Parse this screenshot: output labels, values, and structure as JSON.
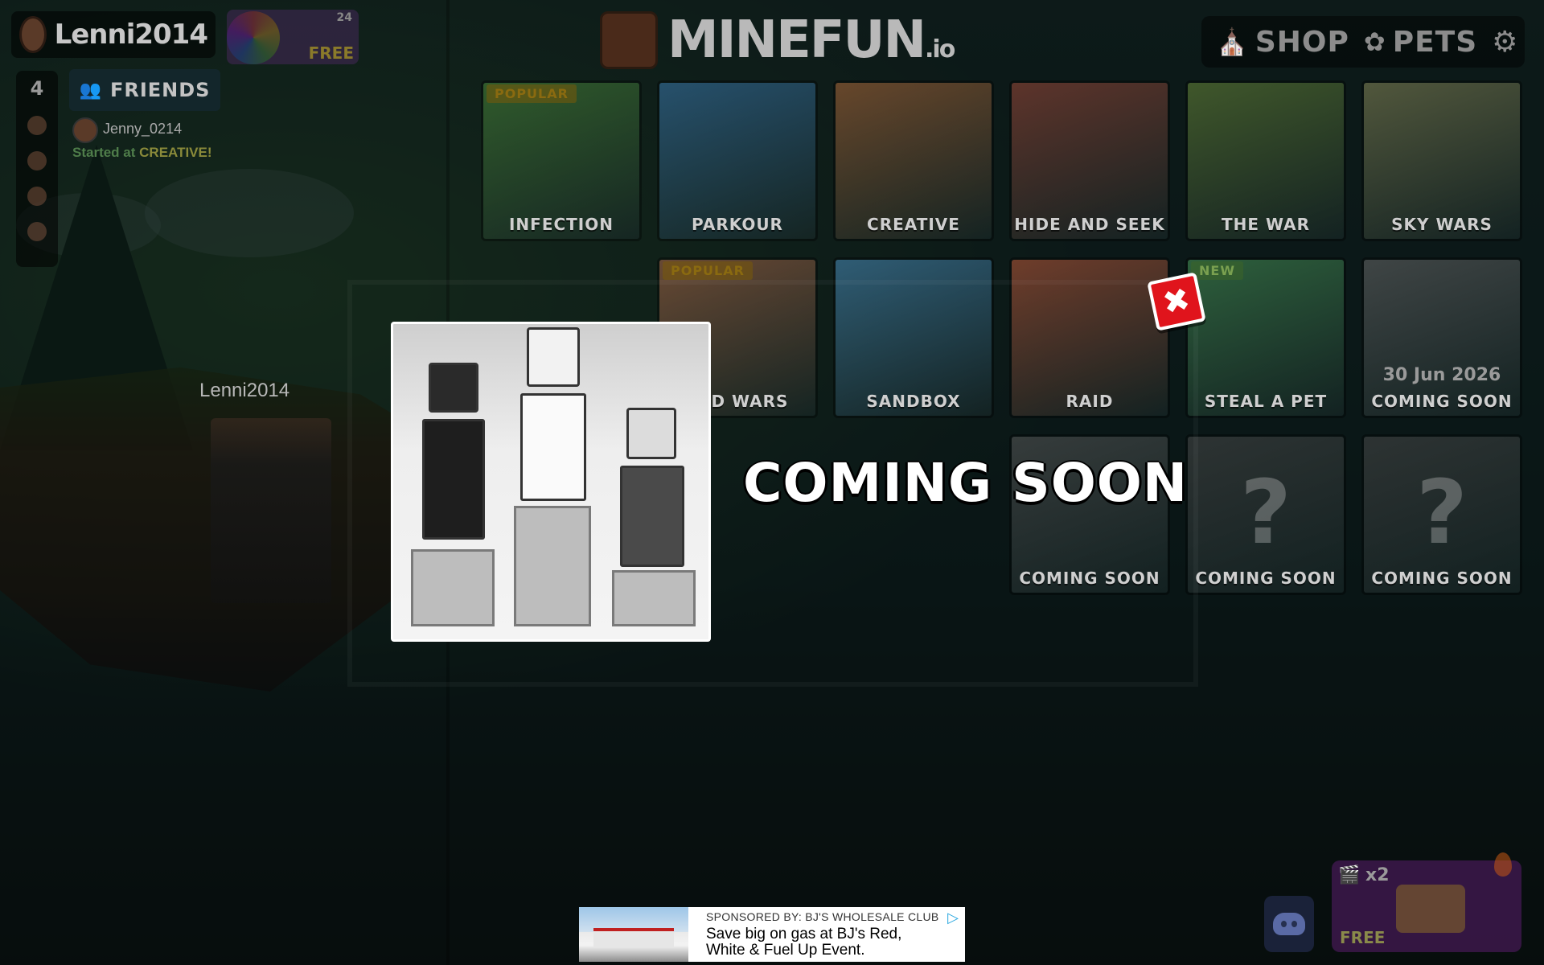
{
  "player": {
    "username": "Lenni2014",
    "nametag": "Lenni2014"
  },
  "wheel": {
    "label": "FREE",
    "badge": "24"
  },
  "friends": {
    "online_count": "4",
    "button_label": "FRIENDS",
    "entry_name": "Jenny_0214",
    "entry_status_prefix": "Started at",
    "entry_status_mode": "CREATIVE!"
  },
  "header": {
    "logo_text": "MINEFUN",
    "logo_suffix": ".io",
    "shop_label": "SHOP",
    "pets_label": "PETS"
  },
  "games": [
    {
      "label": "INFECTION",
      "badge": "POPULAR",
      "color": "#4a8a3a"
    },
    {
      "label": "PARKOUR",
      "badge": "",
      "color": "#3a7ab0"
    },
    {
      "label": "CREATIVE",
      "badge": "",
      "color": "#b06a3a"
    },
    {
      "label": "HIDE AND SEEK",
      "badge": "",
      "color": "#a04a3a"
    },
    {
      "label": "THE WAR",
      "badge": "",
      "color": "#6a8a3a"
    },
    {
      "label": "SKY WARS",
      "badge": "",
      "color": "#8a8a5a"
    },
    {
      "label": "BED WARS",
      "badge": "POPULAR",
      "color": "#b06a4a"
    },
    {
      "label": "SANDBOX",
      "badge": "",
      "color": "#4a90c0"
    },
    {
      "label": "RAID",
      "badge": "",
      "color": "#c05a3a"
    },
    {
      "label": "STEAL A PET",
      "badge": "NEW",
      "color": "#4a9a5a"
    },
    {
      "label": "COMING SOON",
      "badge": "",
      "date": "30 Jun 2026",
      "color": "#6a6a6a"
    },
    {
      "label": "COMING SOON",
      "badge": "",
      "color": "#5a5a5a"
    },
    {
      "label": "COMING SOON",
      "badge": "",
      "question": "?",
      "color": "#4a4a4a"
    },
    {
      "label": "COMING SOON",
      "badge": "",
      "question": "?",
      "color": "#4a4a4a"
    }
  ],
  "overlay": {
    "title": "COMING SOON",
    "close_glyph": "✖"
  },
  "rewards": {
    "multiplier": "x2",
    "label": "FREE"
  },
  "ad": {
    "sponsor": "SPONSORED BY: BJ'S WHOLESALE CLUB",
    "headline": "Save big on gas at BJ's Red, White & Fuel Up Event."
  },
  "colors": {
    "close_button": "#e0141c",
    "ad_choices": "#29a7df"
  }
}
